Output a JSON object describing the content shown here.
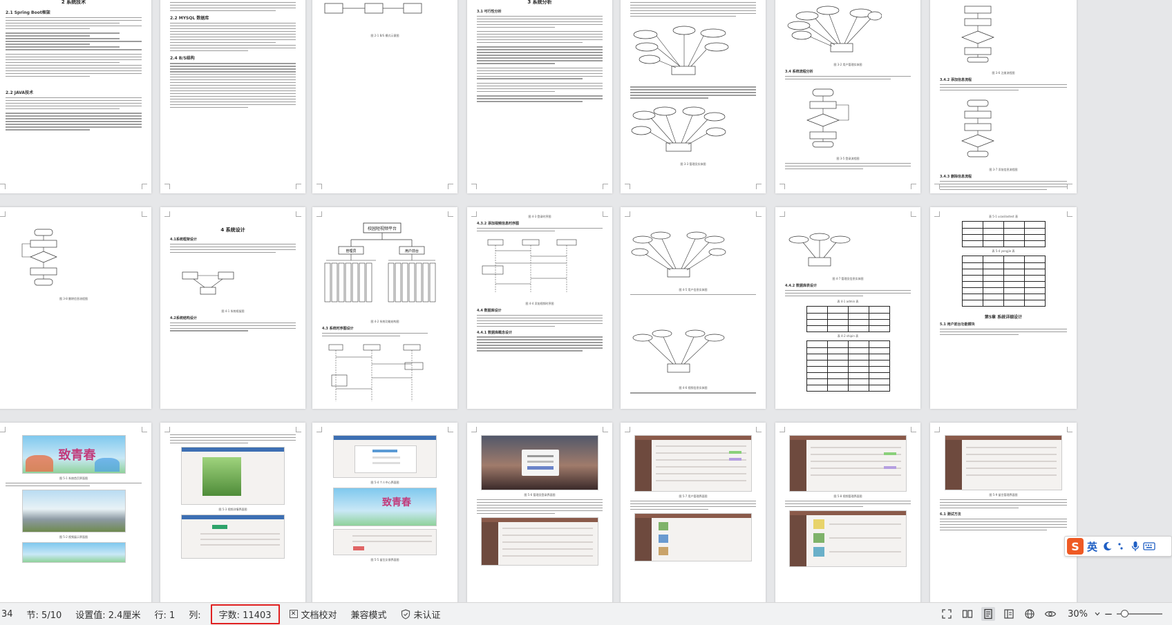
{
  "document": {
    "visible_headings": {
      "spring_boot": "2.1 Spring Boot框架",
      "mysql": "2.2 MYSQL 数据库",
      "bs": "2.4 B/S结构",
      "java": "2.2 JAVA技术",
      "system_design": "4 系统设计",
      "section_design_4_1": "4.1系统框架设计",
      "section_design_4_2": "4.2系统结构设计",
      "section_requirements": "3 系统分析",
      "section_impl": "第5章 系统详细设计",
      "section_5_1": "5.1 用户前台功能模块",
      "section_6_1": "6.1 测试方法"
    },
    "figure_labels": {
      "arch_root": "校园短视频平台",
      "arch_left": "管理员",
      "arch_right": "用户前台",
      "er_center": "管理员",
      "er_center2": "用户",
      "banner_text": "致青春"
    },
    "table_captions": {
      "t1": "表 5-1 ucasilastest 表",
      "t2": "表 5-4 yongjie 表"
    }
  },
  "ime": {
    "logo_letter": "S",
    "language": "英",
    "moon_icon": "moon-icon",
    "punct_icon": "punctuation-icon",
    "mic_icon": "microphone-icon",
    "keyboard_icon": "keyboard-icon"
  },
  "statusbar": {
    "page_partial": "34",
    "section": "节: 5/10",
    "position": "设置值: 2.4厘米",
    "line": "行: 1",
    "column": "列:",
    "word_count": "字数: 11403",
    "proofread": "文档校对",
    "compat_mode": "兼容模式",
    "auth_status": "未认证",
    "zoom": "30%",
    "zoom_level": 0.3,
    "highlight_color": "#e02020"
  }
}
